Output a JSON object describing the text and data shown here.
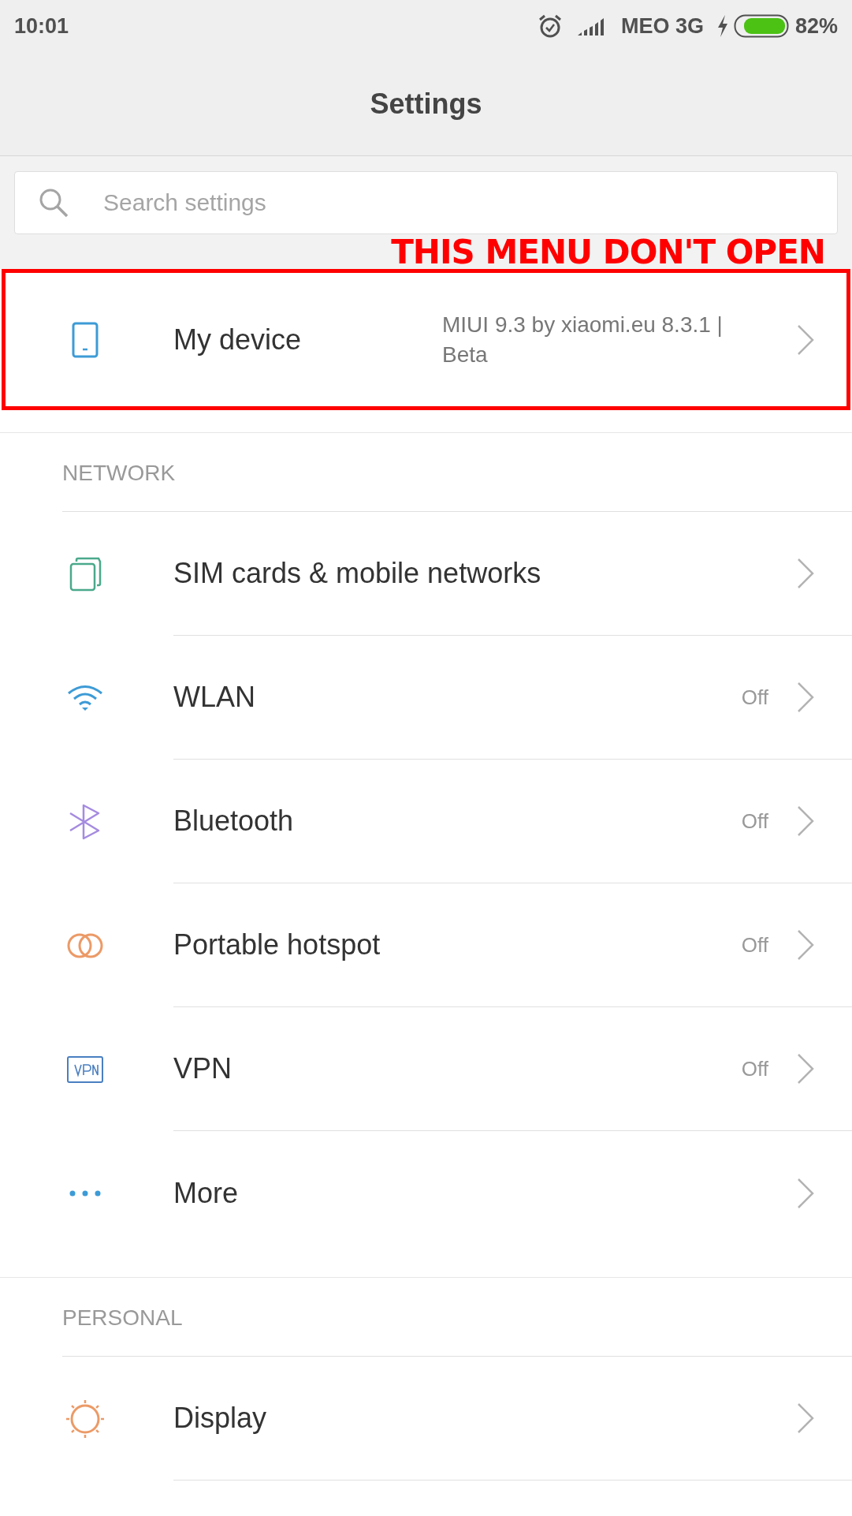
{
  "status_bar": {
    "time": "10:01",
    "carrier": "MEO 3G",
    "battery": "82%"
  },
  "header": {
    "title": "Settings"
  },
  "search": {
    "placeholder": "Search settings"
  },
  "annotation": {
    "text": "THIS MENU DON'T OPEN"
  },
  "sections": [
    {
      "rows": [
        {
          "kind": "device",
          "title": "My device",
          "subtitle": "MIUI 9.3 by xiaomi.eu 8.3.1 | Beta",
          "highlighted": true
        }
      ]
    },
    {
      "heading": "NETWORK",
      "rows": [
        {
          "kind": "sim",
          "title": "SIM cards & mobile networks",
          "highlighted": false
        },
        {
          "kind": "wlan",
          "title": "WLAN",
          "value": "Off",
          "highlighted": false
        },
        {
          "kind": "bluetooth",
          "title": "Bluetooth",
          "value": "Off",
          "highlighted": false
        },
        {
          "kind": "hotspot",
          "title": "Portable hotspot",
          "value": "Off",
          "highlighted": false
        },
        {
          "kind": "vpn",
          "title": "VPN",
          "value": "Off",
          "highlighted": false
        },
        {
          "kind": "more",
          "title": "More",
          "highlighted": false
        }
      ]
    },
    {
      "heading": "PERSONAL",
      "rows": [
        {
          "kind": "display",
          "title": "Display",
          "highlighted": false
        }
      ]
    }
  ]
}
